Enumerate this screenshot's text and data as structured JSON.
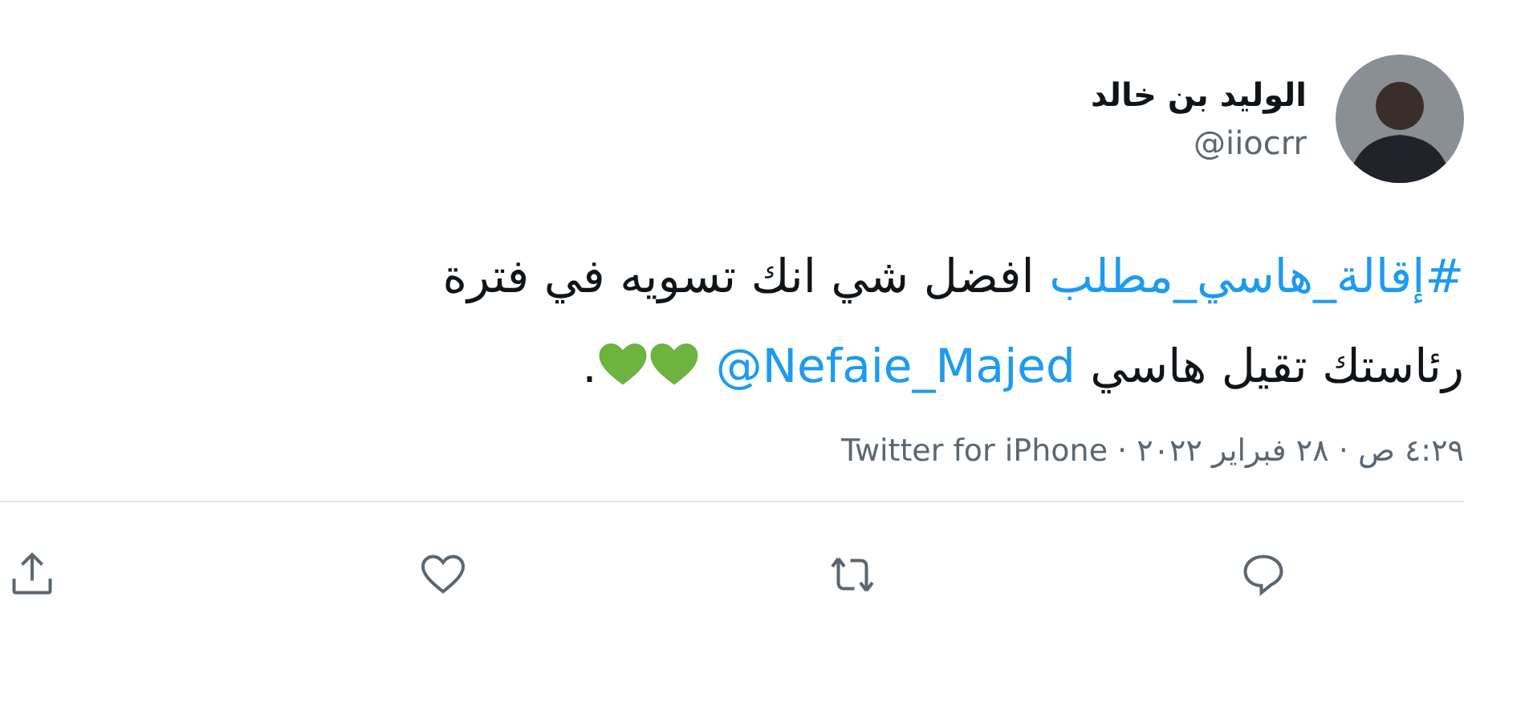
{
  "author": {
    "name": "الوليد بن خالد",
    "handle": "@iiocrr"
  },
  "tweet": {
    "lines": [
      [
        {
          "kind": "hashtag",
          "text": "#إقالة_هاسي_مطلب"
        },
        {
          "kind": "text",
          "text": " افضل شي انك تسويه في فترة"
        }
      ],
      [
        {
          "kind": "text",
          "text": "رئاستك تقيل هاسي "
        },
        {
          "kind": "mention",
          "text": "@Nefaie_Majed"
        },
        {
          "kind": "heart"
        },
        {
          "kind": "heart"
        },
        {
          "kind": "text",
          "text": "."
        }
      ]
    ]
  },
  "meta": "٤:٢٩ ص · ٢٨ فبراير ٢٠٢٢ · Twitter for iPhone",
  "actions": [
    {
      "kind": "reply"
    },
    {
      "kind": "retweet"
    },
    {
      "kind": "like"
    },
    {
      "kind": "share"
    }
  ]
}
